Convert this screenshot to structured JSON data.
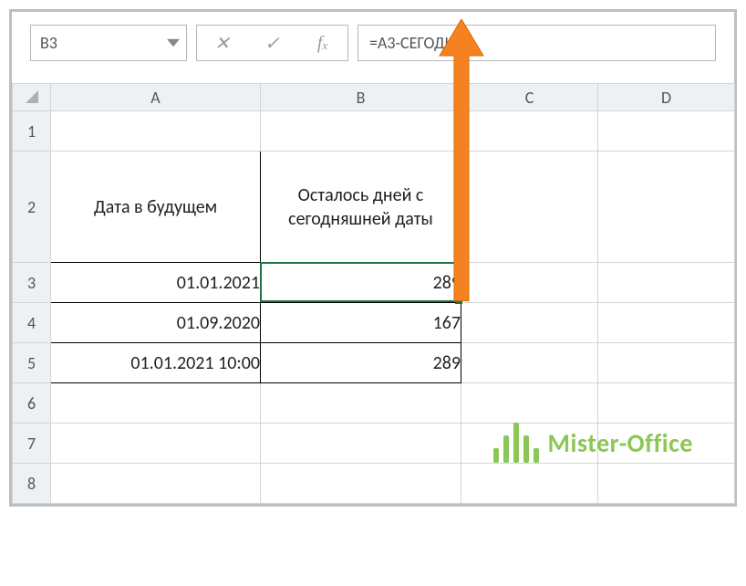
{
  "namebox": {
    "value": "B3"
  },
  "formula": {
    "value": "=A3-СЕГОДНЯ()"
  },
  "columns": [
    "A",
    "B",
    "C",
    "D"
  ],
  "rowNumbers": [
    1,
    2,
    3,
    4,
    5,
    6,
    7,
    8
  ],
  "headers": {
    "A": "Дата в будущем",
    "B": "Осталось дней с сегодняшней даты"
  },
  "rows": [
    {
      "A": "01.01.2021",
      "B": "289"
    },
    {
      "A": "01.09.2020",
      "B": "167"
    },
    {
      "A": "01.01.2021 10:00",
      "B": "289"
    }
  ],
  "watermark": {
    "text": "Mister-Office"
  }
}
